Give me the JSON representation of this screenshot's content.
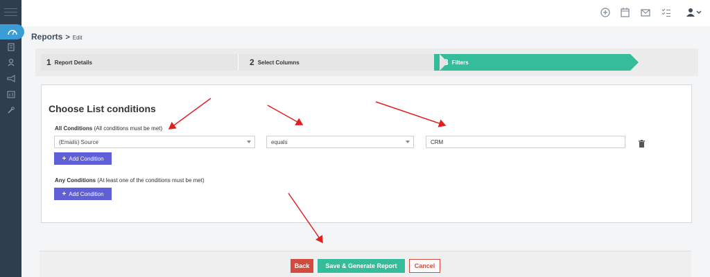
{
  "breadcrumb": {
    "title": "Reports",
    "separator": ">",
    "current": "Edit"
  },
  "wizard": {
    "steps": [
      {
        "number": "1",
        "label": "Report Details",
        "active": false
      },
      {
        "number": "2",
        "label": "Select Columns",
        "active": false
      },
      {
        "number": "3",
        "label": "Filters",
        "active": true
      }
    ]
  },
  "panel": {
    "title": "Choose List conditions",
    "all_conditions": {
      "label": "All Conditions",
      "hint": "(All conditions must be met)",
      "field_value": "(Emails) Source",
      "operator_value": "equals",
      "text_value": "CRM",
      "add_button": "Add Condition"
    },
    "any_conditions": {
      "label": "Any Conditions",
      "hint": "(At least one of the conditions must be met)",
      "add_button": "Add Condition"
    }
  },
  "footer": {
    "back": "Back",
    "save": "Save & Generate Report",
    "cancel": "Cancel"
  },
  "icons": {
    "top": [
      "plus-circle-icon",
      "calendar-icon",
      "mail-icon",
      "tasks-icon",
      "user-icon",
      "chevron-down-icon"
    ],
    "sidebar": [
      "menu-icon",
      "dashboard-icon",
      "calculator-icon",
      "user-icon",
      "megaphone-icon",
      "reports-icon",
      "tools-icon"
    ]
  },
  "colors": {
    "accent": "#35bc9b",
    "sidebar": "#2f3e4e",
    "add_button": "#5f60d8",
    "danger": "#d24b3e",
    "annotation": "#e02020"
  }
}
